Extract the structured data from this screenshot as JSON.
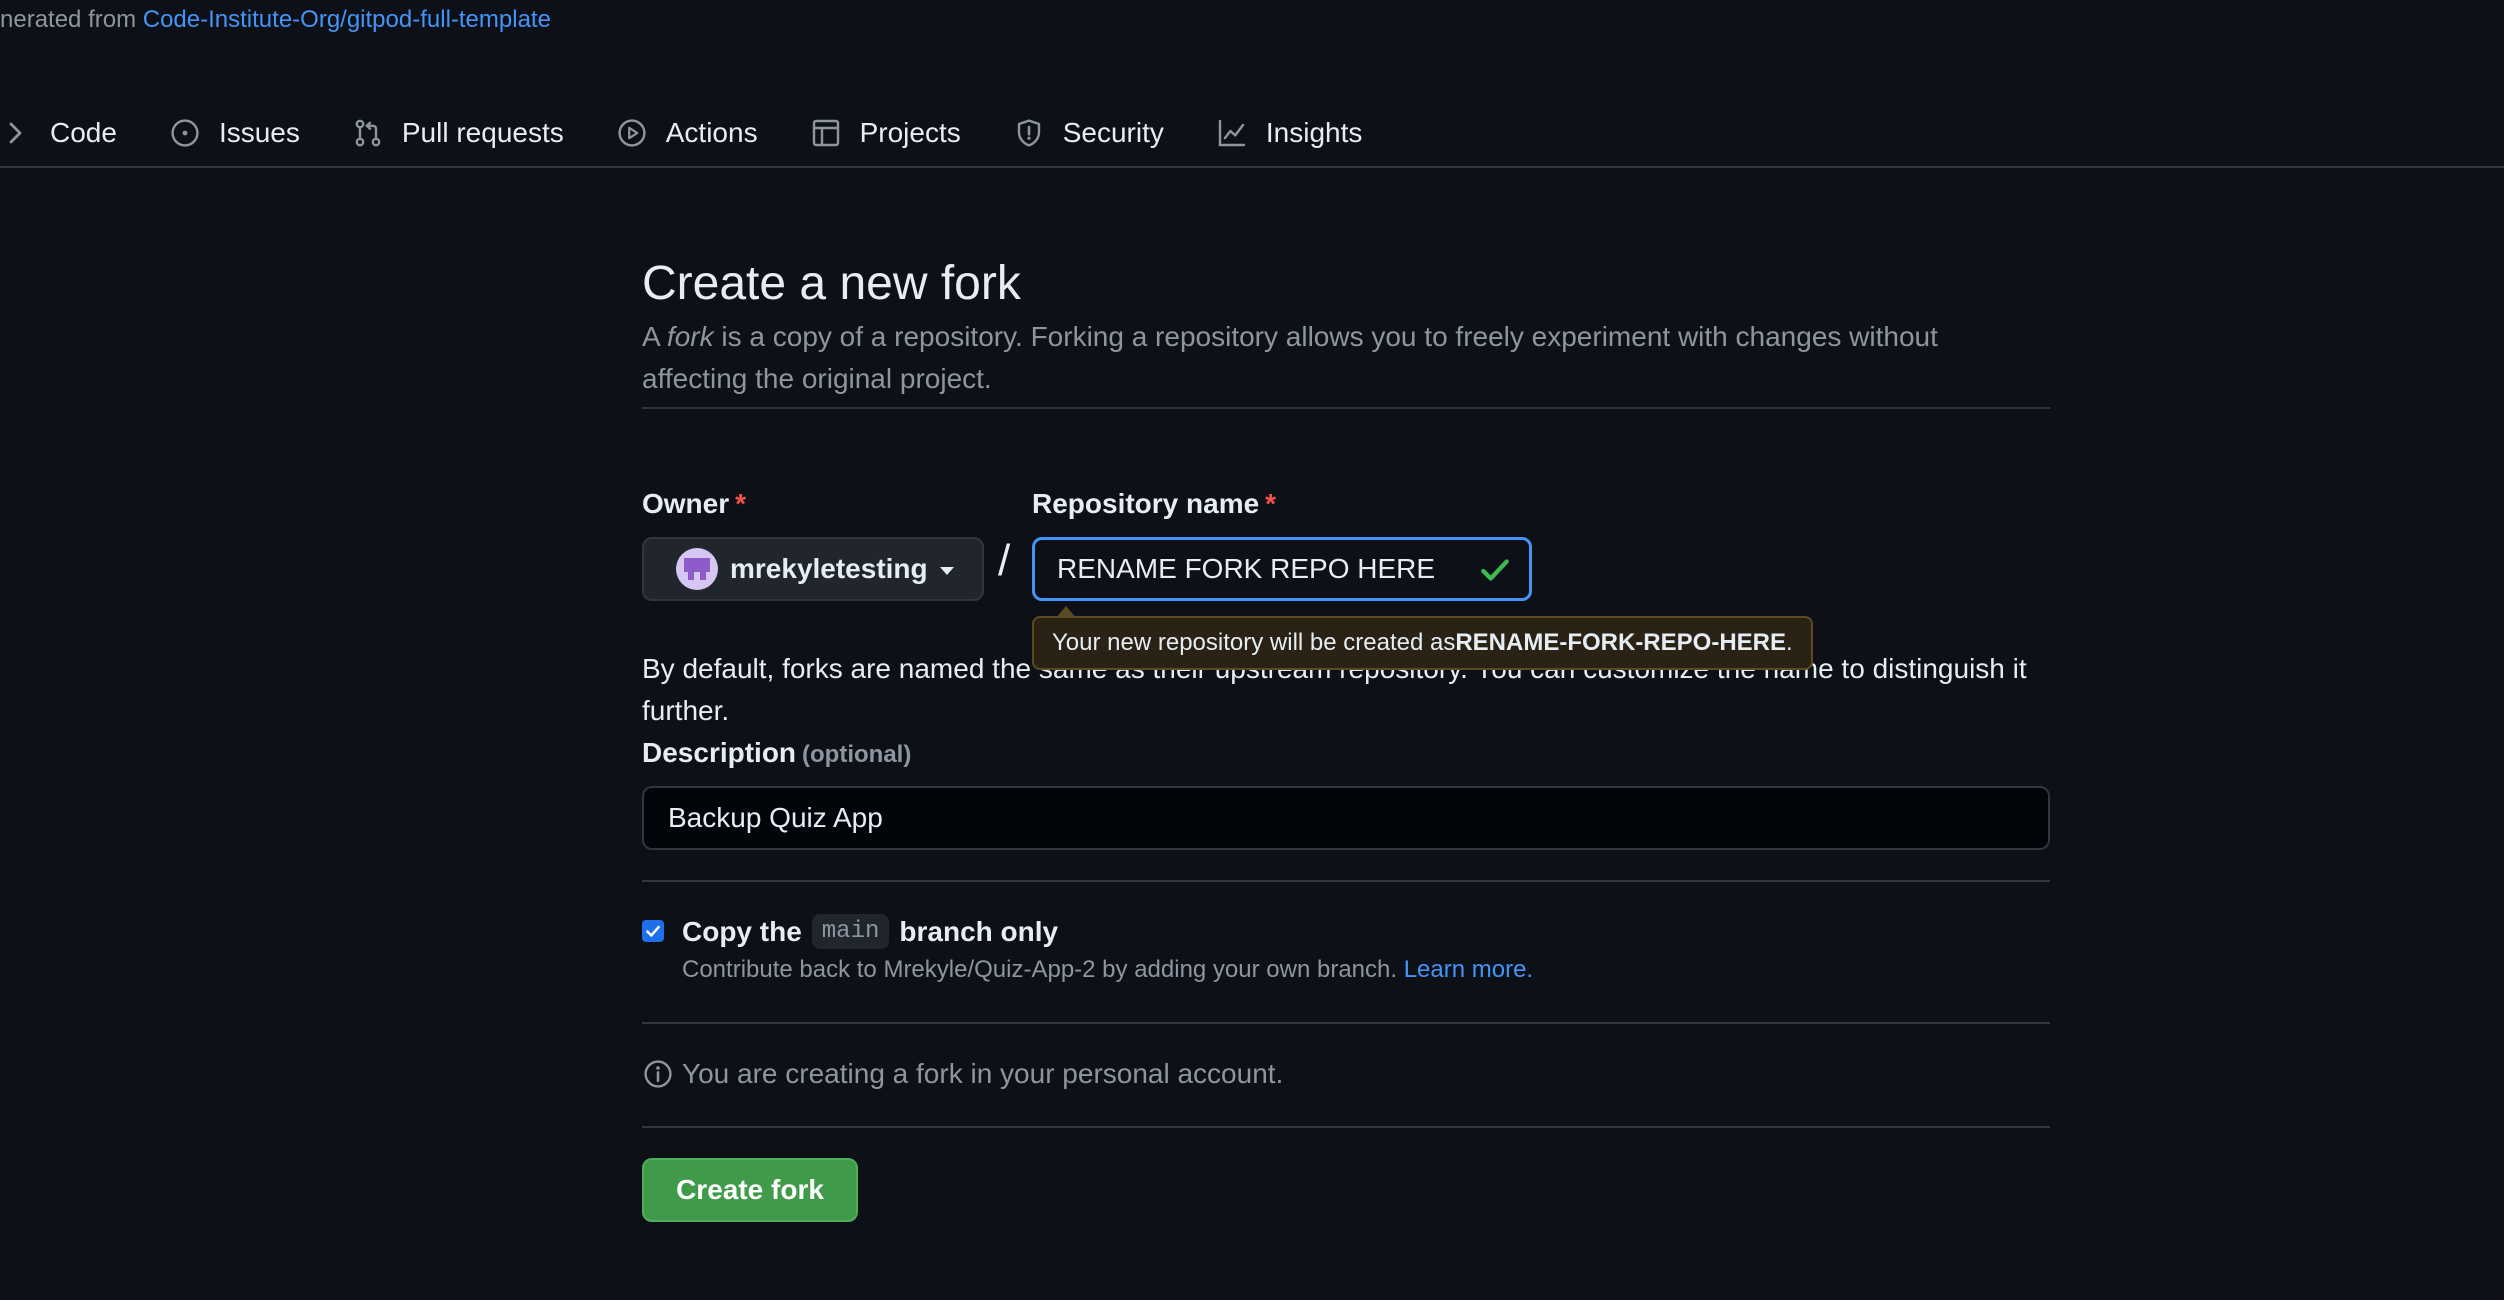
{
  "repo_header": {
    "generated_prefix": "nerated from",
    "template_link": "Code-Institute-Org/gitpod-full-template"
  },
  "nav": {
    "items": [
      {
        "label": "Code",
        "icon": "chevron-right-icon"
      },
      {
        "label": "Issues",
        "icon": "issue-opened-icon"
      },
      {
        "label": "Pull requests",
        "icon": "git-pull-request-icon"
      },
      {
        "label": "Actions",
        "icon": "play-icon"
      },
      {
        "label": "Projects",
        "icon": "table-icon"
      },
      {
        "label": "Security",
        "icon": "shield-icon"
      },
      {
        "label": "Insights",
        "icon": "graph-icon"
      }
    ]
  },
  "page": {
    "title": "Create a new fork",
    "description_a": "A ",
    "description_fork": "fork",
    "description_b": " is a copy of a repository. Forking a repository allows you to freely experiment with changes without affecting the original project."
  },
  "form": {
    "owner_label": "Owner",
    "required_mark": "*",
    "owner_value": "mrekyletesting",
    "slash": "/",
    "repo_label": "Repository name",
    "repo_value": "RENAME FORK REPO HERE",
    "default_help": "By default, forks are named the same as their upstream repository. You can customize the name to distinguish it further.",
    "tooltip_prefix": "Your new repository will be created as ",
    "tooltip_name": "RENAME-FORK-REPO-HERE",
    "tooltip_suffix": ".",
    "description_label": "Description",
    "description_optional": "(optional)",
    "description_value": "Backup Quiz App",
    "copy_branch_checked": true,
    "copy_prefix": "Copy the",
    "copy_branch": "main",
    "copy_suffix": "branch only",
    "copy_sub_text": "Contribute back to Mrekyle/Quiz-App-2 by adding your own branch. ",
    "learn_more": "Learn more.",
    "info_text": "You are creating a fork in your personal account.",
    "submit_label": "Create fork"
  },
  "colors": {
    "background": "#0d1117",
    "link": "#4493f8",
    "accent_green": "#3f9b4a",
    "focus_blue": "#4493f8",
    "required_red": "#f85149",
    "success_check": "#3fb950"
  }
}
